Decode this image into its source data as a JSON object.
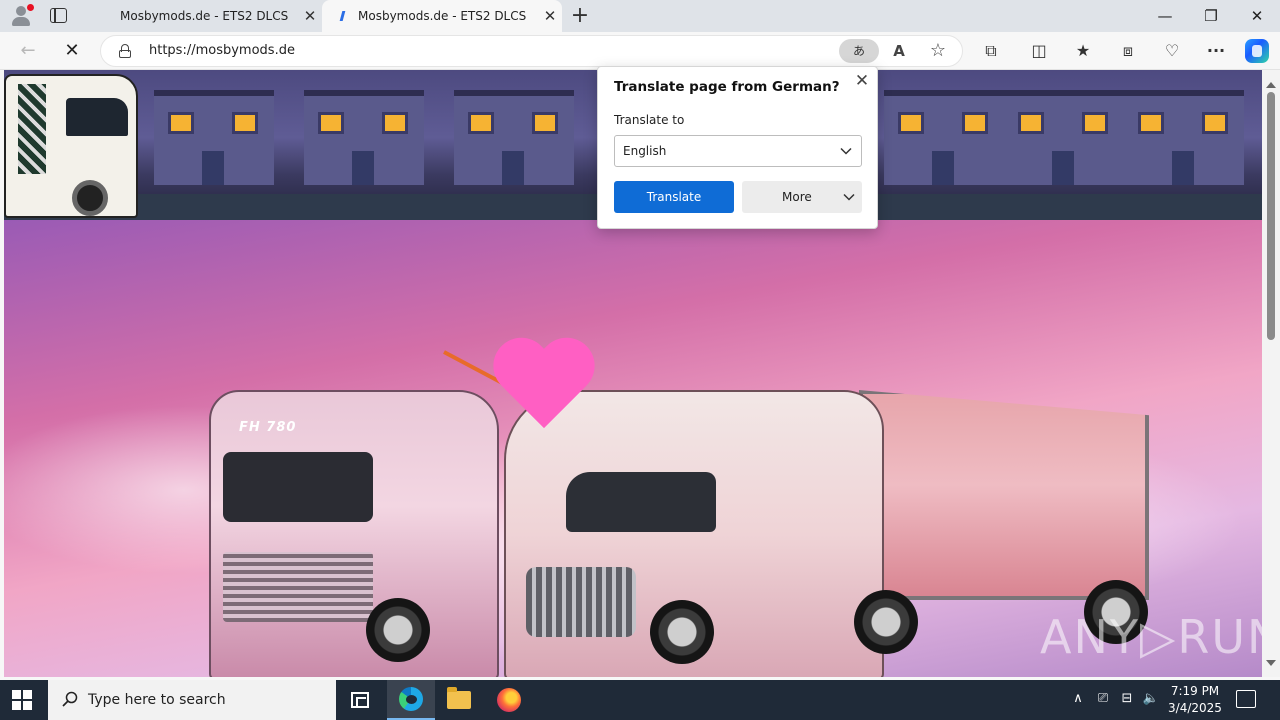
{
  "browser": {
    "tabs": [
      {
        "title": "Mosbymods.de - ETS2 DLCS",
        "active": false
      },
      {
        "title": "Mosbymods.de - ETS2 DLCS",
        "active": true
      }
    ],
    "tab_close_glyph": "✕",
    "new_tab_glyph": "+",
    "window_controls": {
      "minimize": "—",
      "maximize": "❐",
      "close": "✕"
    },
    "address_bar": {
      "url": "https://mosbymods.de",
      "translate_pill_text": "あ"
    },
    "nav": {
      "back": "←",
      "stop": "✕"
    },
    "toolbar_icons": [
      "read-aloud-icon",
      "favorite-star-icon",
      "extensions-icon",
      "split-screen-icon",
      "favorites-icon",
      "collections-icon",
      "browser-essentials-icon",
      "more-icon",
      "copilot-icon"
    ],
    "toolbar_glyphs": {
      "read_aloud": "A",
      "star": "☆",
      "extensions": "⧉",
      "split": "◫",
      "favorites": "★",
      "collections": "⧈",
      "essentials": "♡",
      "more": "···"
    }
  },
  "translate_popup": {
    "title": "Translate page from German?",
    "close_glyph": "✕",
    "label": "Translate to",
    "selected_language": "English",
    "translate_button": "Translate",
    "more_button": "More"
  },
  "page": {
    "watermark": "ANY▷RUN",
    "truck_badge": "FH 780",
    "colors": {
      "accent": "#0f6cd6",
      "heart": "#ff5fc3"
    }
  },
  "taskbar": {
    "search_placeholder": "Type here to search",
    "time": "7:19 PM",
    "date": "3/4/2025",
    "tray_glyphs": {
      "chevron": "∧",
      "meet": "⎚",
      "network": "⊟",
      "volume": "🔈"
    }
  }
}
